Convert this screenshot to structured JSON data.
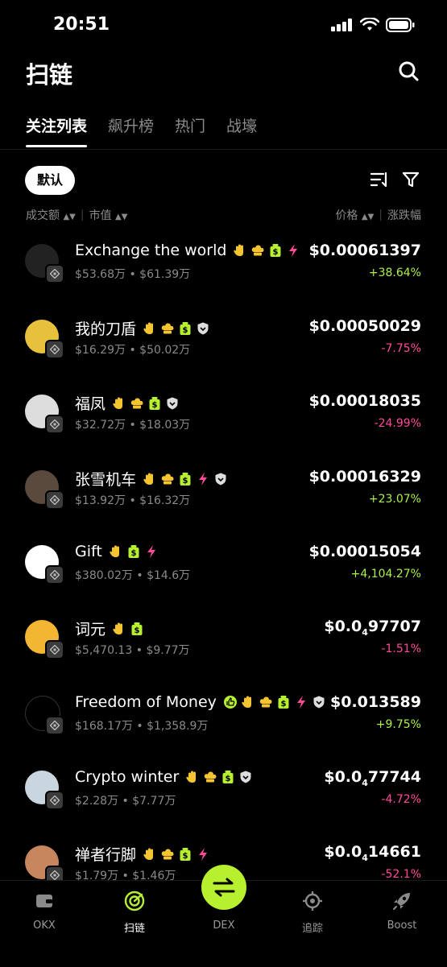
{
  "status": {
    "time": "20:51"
  },
  "header": {
    "title": "扫链"
  },
  "tabs": [
    {
      "label": "关注列表"
    },
    {
      "label": "飙升榜"
    },
    {
      "label": "热门"
    },
    {
      "label": "战壕"
    }
  ],
  "filters": {
    "sort_label": "默认",
    "col_volume": "成交额",
    "col_mcap": "市值",
    "col_price": "价格",
    "col_change": "涨跌幅"
  },
  "colors": {
    "up": "#a9f04a",
    "down": "#ff4b9a",
    "accent": "#b6f02f"
  },
  "tokens": [
    {
      "name": "Exchange the world",
      "volume": "$53.68万",
      "mcap": "$61.39万",
      "price": "$0.00061397",
      "change": "+38.64%",
      "dir": "up",
      "tags": [
        "hand-icon",
        "chef-icon",
        "money-bag-icon",
        "lightning-icon"
      ]
    },
    {
      "name": "我的刀盾",
      "volume": "$16.29万",
      "mcap": "$50.02万",
      "price": "$0.00050029",
      "change": "-7.75%",
      "dir": "down",
      "tags": [
        "hand-icon",
        "chef-icon",
        "money-bag-icon",
        "shield-icon"
      ]
    },
    {
      "name": "福凤",
      "volume": "$32.72万",
      "mcap": "$18.03万",
      "price": "$0.00018035",
      "change": "-24.99%",
      "dir": "down",
      "tags": [
        "hand-icon",
        "chef-icon",
        "money-bag-icon",
        "shield-icon"
      ]
    },
    {
      "name": "张雪机车",
      "volume": "$13.92万",
      "mcap": "$16.32万",
      "price": "$0.00016329",
      "change": "+23.07%",
      "dir": "up",
      "tags": [
        "hand-icon",
        "chef-icon",
        "money-bag-icon",
        "lightning-icon",
        "shield-icon"
      ]
    },
    {
      "name": "Gift",
      "volume": "$380.02万",
      "mcap": "$14.6万",
      "price": "$0.00015054",
      "change": "+4,104.27%",
      "dir": "up",
      "tags": [
        "hand-icon",
        "money-bag-icon",
        "lightning-icon"
      ]
    },
    {
      "name": "词元",
      "volume": "$5,470.13",
      "mcap": "$9.77万",
      "price_main": "$0.0",
      "price_sub": "4",
      "price_tail": "97707",
      "change": "-1.51%",
      "dir": "down",
      "tags": [
        "hand-icon",
        "money-bag-icon"
      ]
    },
    {
      "name": "Freedom of Money",
      "volume": "$168.17万",
      "mcap": "$1,358.9万",
      "price": "$0.013589",
      "change": "+9.75%",
      "dir": "up",
      "tags": [
        "thumb-icon",
        "hand-icon",
        "chef-icon",
        "money-bag-icon",
        "lightning-icon",
        "shield-icon"
      ]
    },
    {
      "name": "Crypto winter",
      "volume": "$2.28万",
      "mcap": "$7.77万",
      "price_main": "$0.0",
      "price_sub": "4",
      "price_tail": "77744",
      "change": "-4.72%",
      "dir": "down",
      "tags": [
        "hand-icon",
        "chef-icon",
        "money-bag-icon",
        "shield-icon"
      ]
    },
    {
      "name": "禅者行脚",
      "volume": "$1.79万",
      "mcap": "$1.46万",
      "price_main": "$0.0",
      "price_sub": "4",
      "price_tail": "14661",
      "change": "-52.1%",
      "dir": "down",
      "tags": [
        "hand-icon",
        "chef-icon",
        "money-bag-icon",
        "lightning-icon"
      ]
    }
  ],
  "bottom_nav": [
    {
      "label": "OKX",
      "icon": "wallet-icon"
    },
    {
      "label": "扫链",
      "icon": "radar-icon"
    },
    {
      "label": "DEX",
      "icon": "swap-icon"
    },
    {
      "label": "追踪",
      "icon": "target-icon"
    },
    {
      "label": "Boost",
      "icon": "rocket-icon"
    }
  ]
}
